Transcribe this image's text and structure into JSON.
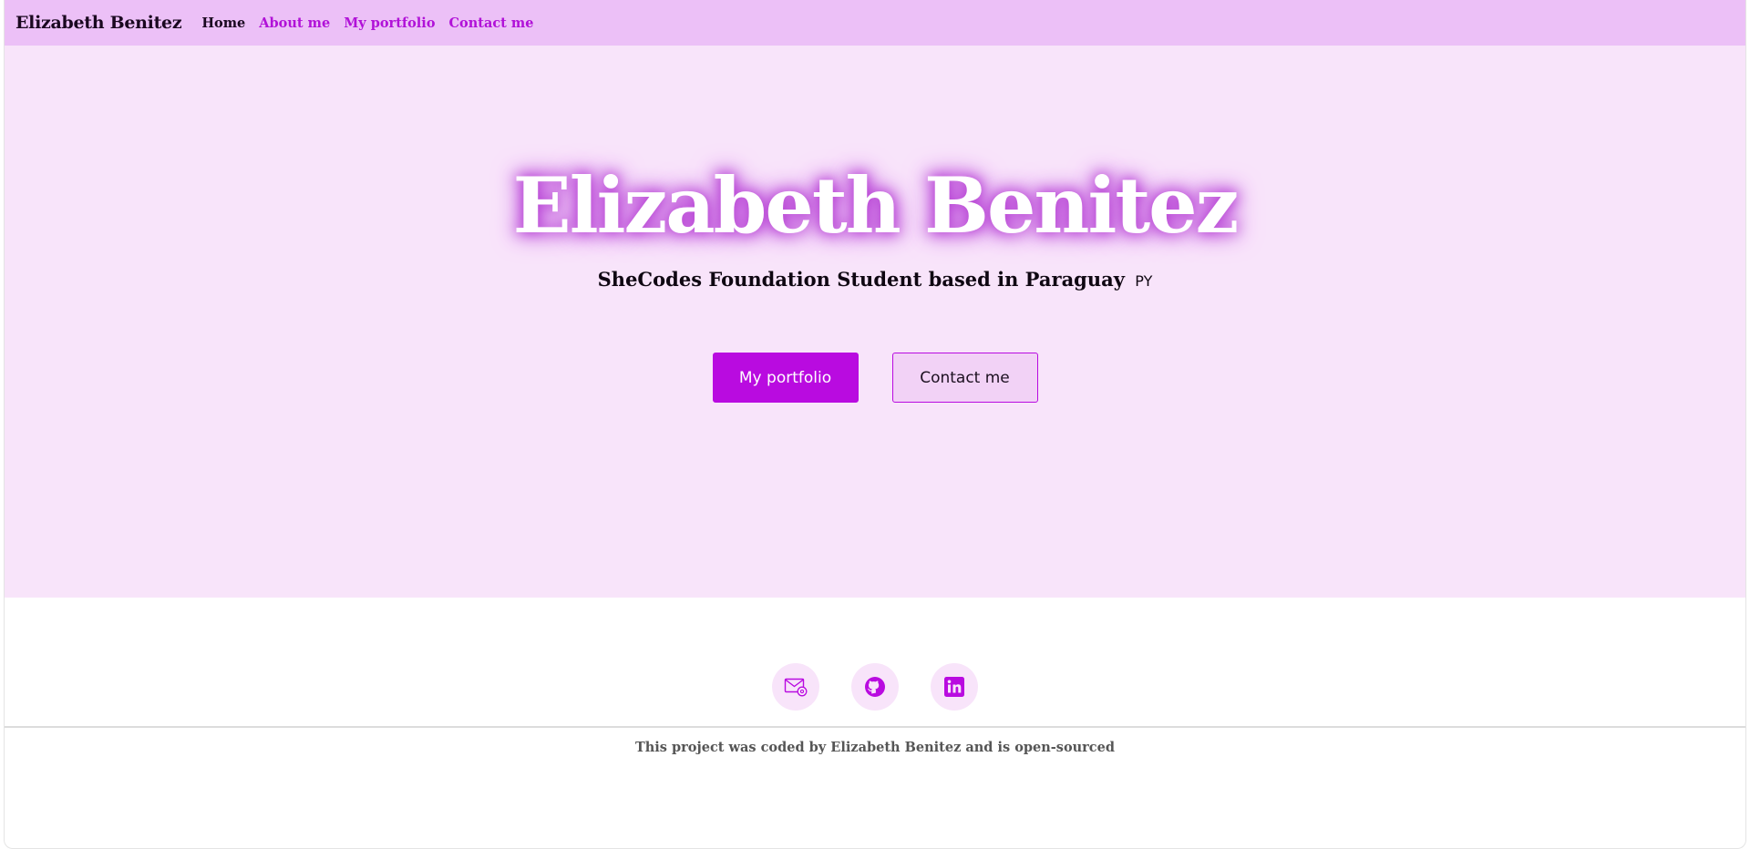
{
  "navbar": {
    "brand": "Elizabeth Benitez",
    "links": [
      {
        "label": "Home",
        "active": true
      },
      {
        "label": "About me",
        "active": false
      },
      {
        "label": "My portfolio",
        "active": false
      },
      {
        "label": "Contact me",
        "active": false
      }
    ]
  },
  "hero": {
    "title": "Elizabeth Benitez",
    "subtitle": "SheCodes Foundation Student based in Paraguay",
    "flag": "PY",
    "buttons": {
      "primary": "My portfolio",
      "secondary": "Contact me"
    }
  },
  "footer": {
    "socials": [
      {
        "icon": "email-icon"
      },
      {
        "icon": "github-icon"
      },
      {
        "icon": "linkedin-icon"
      }
    ],
    "credit": "This project was coded by Elizabeth Benitez and is open-sourced"
  },
  "colors": {
    "navbar_bg": "#ecc0f7",
    "hero_bg": "#f8e4fa",
    "accent": "#b90be0",
    "link": "#b112d8"
  }
}
